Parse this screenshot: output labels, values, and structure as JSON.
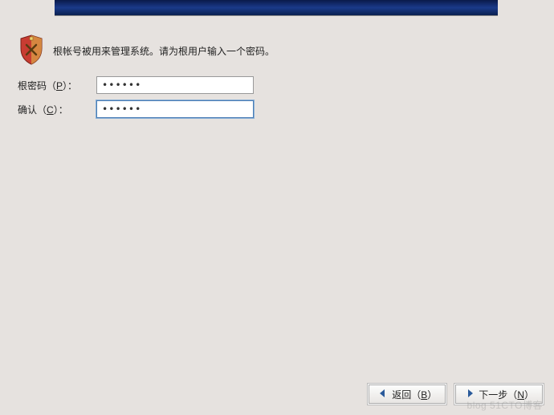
{
  "instruction": {
    "text": "根帐号被用来管理系统。请为根用户输入一个密码。"
  },
  "form": {
    "password_label_pre": "根密码（",
    "password_label_key": "P",
    "password_label_post": "）：",
    "password_value": "••••••",
    "confirm_label_pre": "确认（",
    "confirm_label_key": "C",
    "confirm_label_post": "）：",
    "confirm_value": "••••••"
  },
  "buttons": {
    "back_pre": "返回（",
    "back_key": "B",
    "back_post": "）",
    "next_pre": "下一步（",
    "next_key": "N",
    "next_post": "）"
  },
  "watermark": "blog 51CTO博客"
}
